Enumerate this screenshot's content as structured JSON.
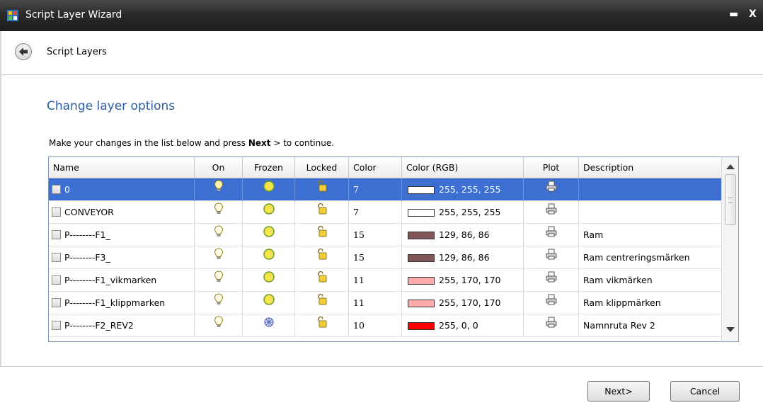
{
  "window": {
    "title": "Script Layer Wizard",
    "minimize": "▬",
    "close": "X"
  },
  "nav": {
    "title": "Script Layers"
  },
  "page": {
    "heading": "Change layer options",
    "instruction_pre": "Make your changes in the list below and press ",
    "instruction_bold": "Next",
    "instruction_post": " > to continue."
  },
  "table": {
    "columns": [
      "Name",
      "On",
      "Frozen",
      "Locked",
      "Color",
      "Color (RGB)",
      "Plot",
      "Description"
    ],
    "rows": [
      {
        "name": "0",
        "on": "lightbulb-on-icon",
        "frozen": "sun-thawed-icon",
        "locked": "lock-open-icon",
        "color": "7",
        "rgb": "255, 255, 255",
        "swatch": "#ffffff",
        "plot": "printer-icon",
        "description": "",
        "selected": true
      },
      {
        "name": "CONVEYOR",
        "on": "lightbulb-on-icon",
        "frozen": "sun-thawed-icon",
        "locked": "lock-open-icon",
        "color": "7",
        "rgb": "255, 255, 255",
        "swatch": "#ffffff",
        "plot": "printer-icon",
        "description": "",
        "selected": false
      },
      {
        "name": "P--------F1_",
        "on": "lightbulb-on-icon",
        "frozen": "sun-thawed-icon",
        "locked": "lock-open-icon",
        "color": "15",
        "rgb": "129, 86, 86",
        "swatch": "#815656",
        "plot": "printer-icon",
        "description": "Ram",
        "selected": false
      },
      {
        "name": "P--------F3_",
        "on": "lightbulb-on-icon",
        "frozen": "sun-thawed-icon",
        "locked": "lock-open-icon",
        "color": "15",
        "rgb": "129, 86, 86",
        "swatch": "#815656",
        "plot": "printer-icon",
        "description": "Ram centreringsmärken",
        "selected": false
      },
      {
        "name": "P--------F1_vikmarken",
        "on": "lightbulb-on-icon",
        "frozen": "sun-thawed-icon",
        "locked": "lock-open-icon",
        "color": "11",
        "rgb": "255, 170, 170",
        "swatch": "#ffaaaa",
        "plot": "printer-icon",
        "description": "Ram vikmärken",
        "selected": false
      },
      {
        "name": "P--------F1_klippmarken",
        "on": "lightbulb-on-icon",
        "frozen": "sun-thawed-icon",
        "locked": "lock-open-icon",
        "color": "11",
        "rgb": "255, 170, 170",
        "swatch": "#ffaaaa",
        "plot": "printer-icon",
        "description": "Ram klippmärken",
        "selected": false
      },
      {
        "name": "P--------F2_REV2",
        "on": "lightbulb-on-icon",
        "frozen": "snowflake-frozen-icon",
        "locked": "lock-open-icon",
        "color": "10",
        "rgb": "255, 0, 0",
        "swatch": "#ff0000",
        "plot": "printer-icon",
        "description": "Namnruta Rev 2",
        "selected": false
      }
    ]
  },
  "buttons": {
    "next": "Next>",
    "cancel": "Cancel"
  },
  "colors": {
    "accent": "#2a5da8",
    "selection": "#3d6fd2",
    "titlebar": "#2b2b2b"
  }
}
